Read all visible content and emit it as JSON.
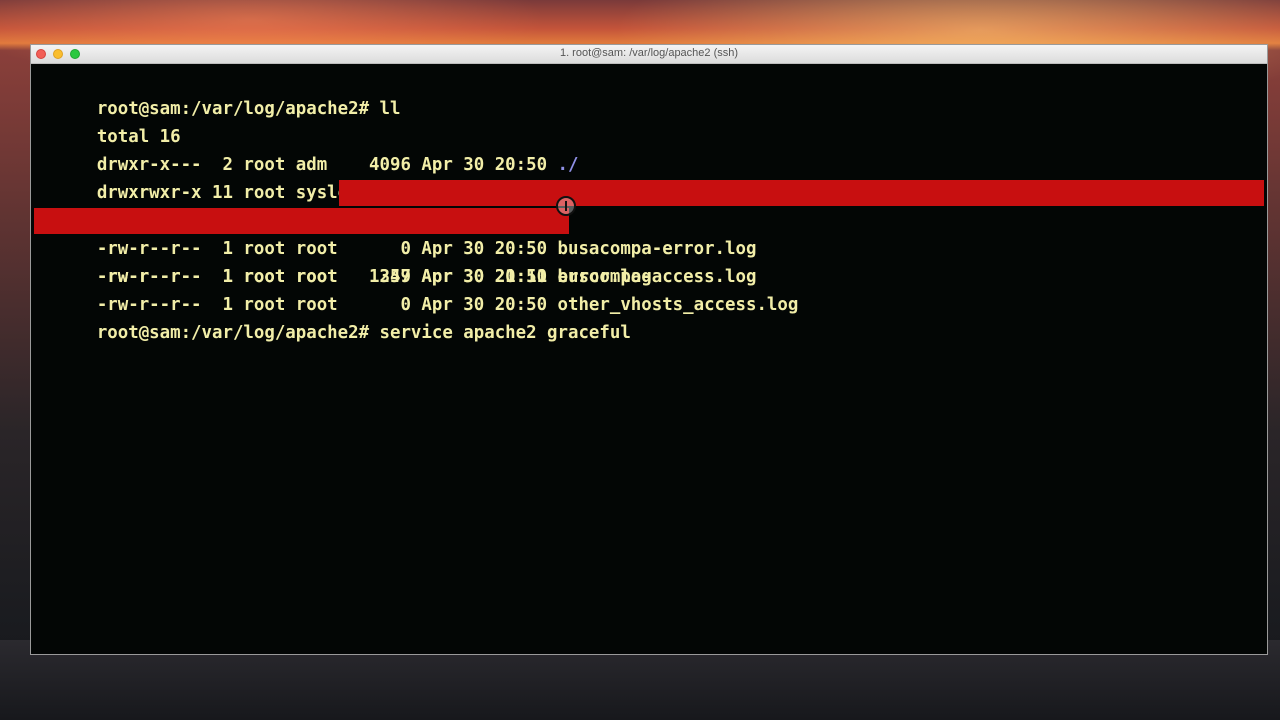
{
  "window": {
    "title": "1. root@sam: /var/log/apache2 (ssh)"
  },
  "terminal": {
    "lines": [
      "root@sam:/var/log/apache2# ll",
      "total 16",
      "drwxr-x---  2 root adm    4096 Apr 30 20:50 ",
      "drwxrwxr-x 11 root syslog 4096 Apr 30 20:09 ",
      "-rw-r--r--  1 root root      0 Apr 30 20:50 busacompa-error.log",
      "-rw-r--r--  1 root root   1347 Apr 30 21:11 buscompa-access.log",
      "-rw-r--r--  1 root root    259 Apr 30 20:50 error.log",
      "-rw-r--r--  1 root root      0 Apr 30 20:50 other_vhosts_access.log",
      "root@sam:/var/log/apache2# service apache2 graceful"
    ],
    "dir_current": "./",
    "dir_parent": "../"
  },
  "colors": {
    "terminal_bg": "#030605",
    "terminal_fg": "#f2eea8",
    "selection": "#c80f10",
    "dir_color": "#8f90e6"
  },
  "icons": {
    "cursor": "text-cursor-icon"
  }
}
